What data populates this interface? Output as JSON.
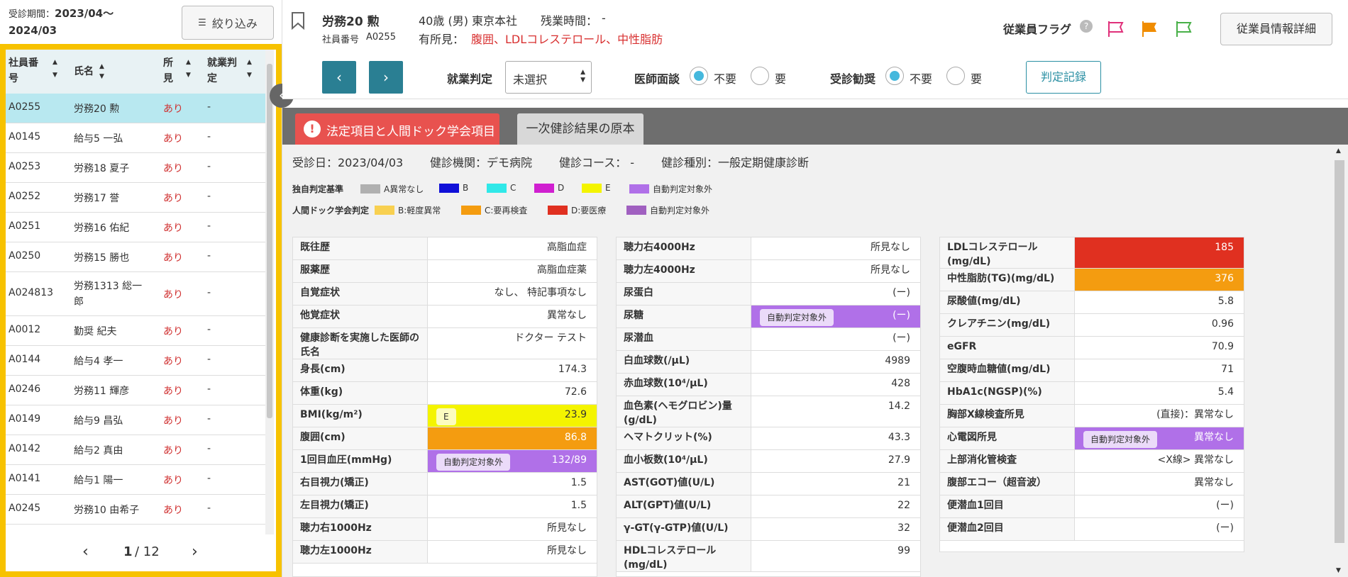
{
  "left_panel": {
    "period_label": "受診期間：",
    "period_value_1": "2023/04〜",
    "period_value_2": "2024/03",
    "filter_icon": "filter-icon",
    "filter_label": "絞り込み",
    "columns": [
      "社員番号",
      "氏名",
      "所見",
      "就業判定"
    ],
    "column_lines": {
      "c1a": "社員番",
      "c1b": "号",
      "c2": "氏名",
      "c3a": "所",
      "c3b": "見",
      "c4a": "就業判",
      "c4b": "定"
    },
    "rows": [
      {
        "id": "A0255",
        "name": "労務20 勲",
        "finding": "あり",
        "judgment": "-"
      },
      {
        "id": "A0145",
        "name": "給与5 一弘",
        "finding": "あり",
        "judgment": "-"
      },
      {
        "id": "A0253",
        "name": "労務18 夏子",
        "finding": "あり",
        "judgment": "-"
      },
      {
        "id": "A0252",
        "name": "労務17 誉",
        "finding": "あり",
        "judgment": "-"
      },
      {
        "id": "A0251",
        "name": "労務16 佑紀",
        "finding": "あり",
        "judgment": "-"
      },
      {
        "id": "A0250",
        "name": "労務15 勝也",
        "finding": "あり",
        "judgment": "-"
      },
      {
        "id": "A024813",
        "name": "労務1313 総一郎",
        "name_a": "労務1313 総一",
        "name_b": "郎",
        "finding": "あり",
        "judgment": "-"
      },
      {
        "id": "A0012",
        "name": "勤奨 紀夫",
        "finding": "あり",
        "judgment": "-"
      },
      {
        "id": "A0144",
        "name": "給与4 孝一",
        "finding": "あり",
        "judgment": "-"
      },
      {
        "id": "A0246",
        "name": "労務11 輝彦",
        "finding": "あり",
        "judgment": "-"
      },
      {
        "id": "A0149",
        "name": "給与9 昌弘",
        "finding": "あり",
        "judgment": "-"
      },
      {
        "id": "A0142",
        "name": "給与2 真由",
        "finding": "あり",
        "judgment": "-"
      },
      {
        "id": "A0141",
        "name": "給与1 陽一",
        "finding": "あり",
        "judgment": "-"
      },
      {
        "id": "A0245",
        "name": "労務10 由希子",
        "finding": "あり",
        "judgment": "-"
      }
    ],
    "pager": {
      "current": "1",
      "total": "/ 12",
      "prev": "‹",
      "next": "›"
    }
  },
  "employee": {
    "name": "労務20 勲",
    "number_label": "社員番号",
    "number": "A0255",
    "profile": "40歳 (男) 東京本社",
    "overtime_label": "残業時間：",
    "overtime_value": "-",
    "findings_label": "有所見：",
    "findings_value": "腹囲、LDLコレステロール、中性脂肪",
    "flag_label": "従業員フラグ",
    "detail_button": "従業員情報詳細"
  },
  "controls": {
    "prev": "‹",
    "next": "›",
    "work_judgment_label": "就業判定",
    "work_judgment_value": "未選択",
    "doctor_label": "医師面談",
    "doctor_opt1": "不要",
    "doctor_opt2": "要",
    "recommend_label": "受診勧奨",
    "recommend_opt1": "不要",
    "recommend_opt2": "要",
    "record_button": "判定記録"
  },
  "tabs": {
    "tab1": "法定項目と人間ドック学会項目",
    "tab2": "一次健診結果の原本"
  },
  "exam": {
    "date": "受診日：2023/04/03",
    "institution": "健診機関：デモ病院",
    "course": "健診コース： -",
    "type": "健診種別：一般定期健康診断"
  },
  "legend1": {
    "title": "独自判定基準",
    "items": [
      {
        "label": "A異常なし",
        "color": "#b0b0b0"
      },
      {
        "label": "B",
        "color": "#1010d8"
      },
      {
        "label": "C",
        "color": "#30e8e8"
      },
      {
        "label": "D",
        "color": "#d020d0"
      },
      {
        "label": "E",
        "color": "#f4f400"
      },
      {
        "label": "自動判定対象外",
        "color": "#b070e8"
      }
    ]
  },
  "legend2": {
    "title": "人間ドック学会判定",
    "items": [
      {
        "label": "B:軽度異常",
        "color": "#f8d050"
      },
      {
        "label": "C:要再検査",
        "color": "#f49c10"
      },
      {
        "label": "D:要医療",
        "color": "#e03020"
      },
      {
        "label": "自動判定対象外",
        "color": "#a060c0"
      }
    ]
  },
  "table1": [
    {
      "k": "既往歴",
      "v": "高脂血症"
    },
    {
      "k": "服薬歴",
      "v": "高脂血症薬"
    },
    {
      "k": "自覚症状",
      "v": "なし、 特記事項なし"
    },
    {
      "k": "他覚症状",
      "v": "異常なし"
    },
    {
      "k": "健康診断を実施した医師の氏名",
      "v": "ドクター テスト"
    },
    {
      "k": "身長(cm)",
      "v": "174.3"
    },
    {
      "k": "体重(kg)",
      "v": "72.6"
    },
    {
      "k": "BMI(kg/m²)",
      "v": "23.9",
      "tag": "E"
    },
    {
      "k": "腹囲(cm)",
      "v": "86.8"
    },
    {
      "k": "1回目血圧(mmHg)",
      "v": "132/89",
      "tag": "自動判定対象外"
    },
    {
      "k": "右目視力(矯正)",
      "v": "1.5"
    },
    {
      "k": "左目視力(矯正)",
      "v": "1.5"
    },
    {
      "k": "聴力右1000Hz",
      "v": "所見なし"
    },
    {
      "k": "聴力左1000Hz",
      "v": "所見なし"
    }
  ],
  "table2": [
    {
      "k": "聴力右4000Hz",
      "v": "所見なし"
    },
    {
      "k": "聴力左4000Hz",
      "v": "所見なし"
    },
    {
      "k": "尿蛋白",
      "v": "(ー)"
    },
    {
      "k": "尿糖",
      "v": "(ー)",
      "tag": "自動判定対象外"
    },
    {
      "k": "尿潜血",
      "v": "(ー)"
    },
    {
      "k": "白血球数(/μL)",
      "v": "4989"
    },
    {
      "k": "赤血球数(10⁴/μL)",
      "v": "428"
    },
    {
      "k": "血色素(ヘモグロビン)量(g/dL)",
      "v": "14.2"
    },
    {
      "k": "ヘマトクリット(%)",
      "v": "43.3"
    },
    {
      "k": "血小板数(10⁴/μL)",
      "v": "27.9"
    },
    {
      "k": "AST(GOT)値(U/L)",
      "v": "21"
    },
    {
      "k": "ALT(GPT)値(U/L)",
      "v": "22"
    },
    {
      "k": "γ-GT(γ-GTP)値(U/L)",
      "v": "32"
    },
    {
      "k": "HDLコレステロール(mg/dL)",
      "v": "99"
    }
  ],
  "table3": [
    {
      "k": "LDLコレステロール(mg/dL)",
      "v": "185"
    },
    {
      "k": "中性脂肪(TG)(mg/dL)",
      "v": "376"
    },
    {
      "k": "尿酸値(mg/dL)",
      "v": "5.8"
    },
    {
      "k": "クレアチニン(mg/dL)",
      "v": "0.96"
    },
    {
      "k": "eGFR",
      "v": "70.9"
    },
    {
      "k": "空腹時血糖値(mg/dL)",
      "v": "71"
    },
    {
      "k": "HbA1c(NGSP)(%)",
      "v": "5.4"
    },
    {
      "k": "胸部X線検査所見",
      "v": "(直接)：異常なし"
    },
    {
      "k": "心電図所見",
      "v": "異常なし",
      "tag": "自動判定対象外"
    },
    {
      "k": "上部消化管検査",
      "v": "<X線> 異常なし"
    },
    {
      "k": "腹部エコー（超音波）",
      "v": "異常なし"
    },
    {
      "k": "便潜血1回目",
      "v": "(ー)"
    },
    {
      "k": "便潜血2回目",
      "v": "(ー)"
    }
  ]
}
